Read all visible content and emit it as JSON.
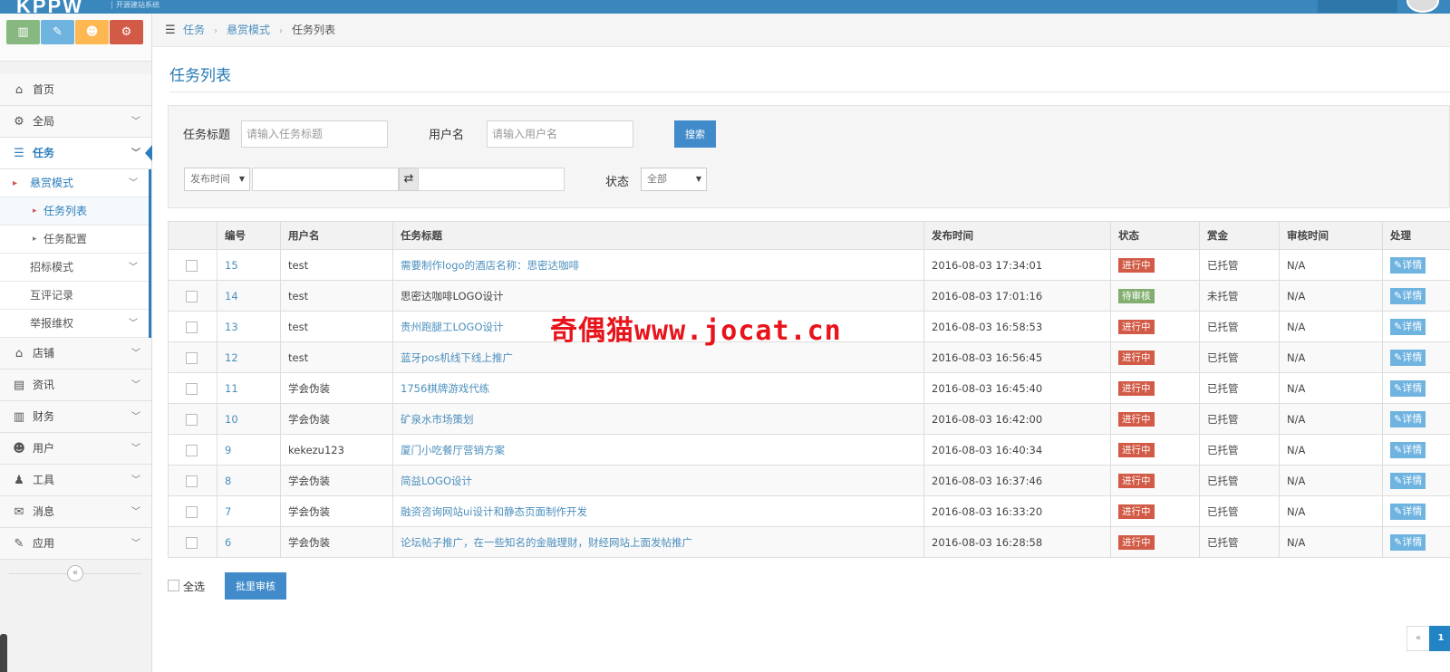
{
  "topbar": {
    "logo": "KPPW",
    "logo_sub": "开源建站系统",
    "color": "#3a87bd"
  },
  "sidebar": {
    "shortcuts": [
      {
        "icon": "bar-chart-icon",
        "color": "#87b87f"
      },
      {
        "icon": "pencil-icon",
        "color": "#6fb3e0"
      },
      {
        "icon": "users-icon",
        "color": "#ffb752"
      },
      {
        "icon": "cogs-icon",
        "color": "#d15b47"
      }
    ],
    "items": [
      {
        "label": "首页",
        "icon": "home-icon"
      },
      {
        "label": "全局",
        "icon": "cog-icon"
      },
      {
        "label": "任务",
        "icon": "list-icon",
        "active": true
      },
      {
        "label": "店铺",
        "icon": "home-icon"
      },
      {
        "label": "资讯",
        "icon": "file-icon"
      },
      {
        "label": "财务",
        "icon": "bar-chart-icon"
      },
      {
        "label": "用户",
        "icon": "users-icon"
      },
      {
        "label": "工具",
        "icon": "user-icon"
      },
      {
        "label": "消息",
        "icon": "envelope-icon"
      },
      {
        "label": "应用",
        "icon": "edit-icon"
      }
    ],
    "task_sub": [
      {
        "label": "悬赏模式"
      },
      {
        "label": "招标模式"
      },
      {
        "label": "互评记录"
      },
      {
        "label": "举报维权"
      }
    ],
    "bounty_sub": [
      {
        "label": "任务列表"
      },
      {
        "label": "任务配置"
      }
    ],
    "collapse_glyph": "«"
  },
  "breadcrumb": {
    "items": [
      "任务",
      "悬赏模式",
      "任务列表"
    ]
  },
  "page_title": "任务列表",
  "filter": {
    "title_label": "任务标题",
    "title_placeholder": "请输入任务标题",
    "user_label": "用户名",
    "user_placeholder": "请输入用户名",
    "search_button": "搜索",
    "date_select": "发布时间",
    "status_label": "状态",
    "status_select": "全部"
  },
  "table": {
    "headers": [
      "编号",
      "用户名",
      "任务标题",
      "发布时间",
      "状态",
      "赏金",
      "审核时间",
      "处理"
    ],
    "detail_label": "详情",
    "rows": [
      {
        "id": "15",
        "user": "test",
        "title": "需要制作logo的酒店名称：思密达咖啡",
        "title_link": true,
        "time": "2016-08-03 17:34:01",
        "status": "进行中",
        "status_color": "#d15b47",
        "bounty": "已托管",
        "review": "N/A"
      },
      {
        "id": "14",
        "user": "test",
        "title": "思密达咖啡LOGO设计",
        "title_link": false,
        "time": "2016-08-03 17:01:16",
        "status": "待审核",
        "status_color": "#82af6f",
        "bounty": "未托管",
        "review": "N/A"
      },
      {
        "id": "13",
        "user": "test",
        "title": "贵州跑腿工LOGO设计",
        "title_link": true,
        "time": "2016-08-03 16:58:53",
        "status": "进行中",
        "status_color": "#d15b47",
        "bounty": "已托管",
        "review": "N/A"
      },
      {
        "id": "12",
        "user": "test",
        "title": "蓝牙pos机线下线上推广",
        "title_link": true,
        "time": "2016-08-03 16:56:45",
        "status": "进行中",
        "status_color": "#d15b47",
        "bounty": "已托管",
        "review": "N/A"
      },
      {
        "id": "11",
        "user": "学会伪装",
        "title": "1756棋牌游戏代练",
        "title_link": true,
        "time": "2016-08-03 16:45:40",
        "status": "进行中",
        "status_color": "#d15b47",
        "bounty": "已托管",
        "review": "N/A"
      },
      {
        "id": "10",
        "user": "学会伪装",
        "title": "矿泉水市场策划",
        "title_link": true,
        "time": "2016-08-03 16:42:00",
        "status": "进行中",
        "status_color": "#d15b47",
        "bounty": "已托管",
        "review": "N/A"
      },
      {
        "id": "9",
        "user": "kekezu123",
        "title": "厦门小吃餐厅营销方案",
        "title_link": true,
        "time": "2016-08-03 16:40:34",
        "status": "进行中",
        "status_color": "#d15b47",
        "bounty": "已托管",
        "review": "N/A"
      },
      {
        "id": "8",
        "user": "学会伪装",
        "title": "简益LOGO设计",
        "title_link": true,
        "time": "2016-08-03 16:37:46",
        "status": "进行中",
        "status_color": "#d15b47",
        "bounty": "已托管",
        "review": "N/A"
      },
      {
        "id": "7",
        "user": "学会伪装",
        "title": "融资咨询网站ui设计和静态页面制作开发",
        "title_link": true,
        "time": "2016-08-03 16:33:20",
        "status": "进行中",
        "status_color": "#d15b47",
        "bounty": "已托管",
        "review": "N/A"
      },
      {
        "id": "6",
        "user": "学会伪装",
        "title": "论坛帖子推广，在一些知名的金融理财，财经网站上面发帖推广",
        "title_link": true,
        "time": "2016-08-03 16:28:58",
        "status": "进行中",
        "status_color": "#d15b47",
        "bounty": "已托管",
        "review": "N/A"
      }
    ]
  },
  "bulk": {
    "select_all": "全选",
    "bulk_button": "批里审核"
  },
  "pager": {
    "prev": "«",
    "current": "1"
  },
  "watermark": "奇偶猫www.jocat.cn"
}
